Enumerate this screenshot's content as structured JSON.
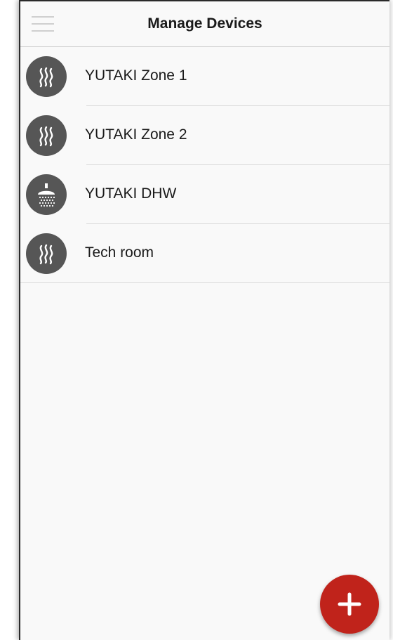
{
  "header": {
    "title": "Manage Devices",
    "menu_icon": "hamburger-menu-icon"
  },
  "devices": [
    {
      "name": "YUTAKI Zone 1",
      "icon": "heating-waves-icon"
    },
    {
      "name": "YUTAKI Zone 2",
      "icon": "heating-waves-icon"
    },
    {
      "name": "YUTAKI DHW",
      "icon": "shower-icon"
    },
    {
      "name": "Tech room",
      "icon": "heating-waves-icon"
    }
  ],
  "fab": {
    "icon": "plus-icon",
    "color": "#c0231b"
  },
  "colors": {
    "icon_bg": "#565656",
    "background": "#f9f9f9",
    "divider": "#dcdcdc"
  }
}
